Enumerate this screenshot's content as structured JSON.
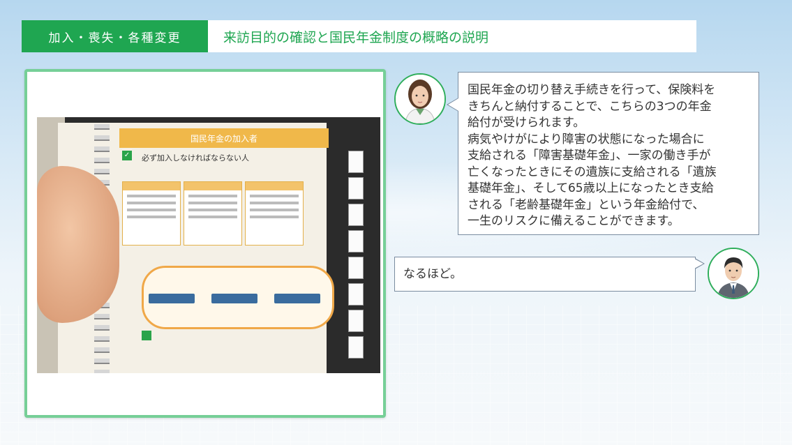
{
  "header": {
    "section_tag": "加入・喪失・各種変更",
    "title": "来訪目的の確認と国民年金制度の概略の説明"
  },
  "video": {
    "pamphlet_title": "国民年金の加入者",
    "pamphlet_heading": "必ず加入しなければならない人"
  },
  "dialog": {
    "staff_lines": [
      "国民年金の切り替え手続きを行って、保険料を",
      "きちんと納付することで、こちらの3つの年金",
      "給付が受けられます。",
      "病気やけがにより障害の状態になった場合に",
      "支給される「障害基礎年金」、一家の働き手が",
      "亡くなったときにその遺族に支給される「遺族",
      "基礎年金」、そして65歳以上になったとき支給",
      "される「老齢基礎年金」という年金給付で、",
      "一生のリスクに備えることができます。"
    ],
    "visitor_text": "なるほど。"
  },
  "colors": {
    "accent_green": "#1fa651",
    "frame_green": "#76cf97",
    "bubble_border": "#7a8ca0"
  },
  "icons": {
    "staff_avatar": "female-staff-avatar",
    "visitor_avatar": "male-visitor-avatar"
  }
}
